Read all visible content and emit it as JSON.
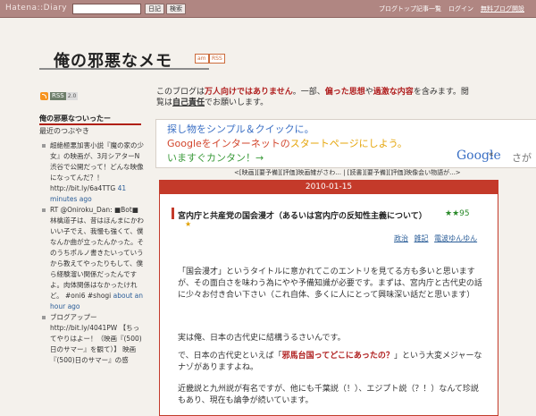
{
  "topbar": {
    "logo": "Hatena::Diary",
    "search_placeholder": "",
    "btn_diary": "日記",
    "btn_search": "検索",
    "links": [
      "ブログトップ",
      "記事一覧",
      "ログイン",
      "無料ブログ開設"
    ]
  },
  "blog": {
    "title": "俺の邪悪なメモ",
    "tag_am": "am",
    "tag_rss": "RSS"
  },
  "sidebar": {
    "rss_label": "RSS",
    "rss_version": "2.0",
    "heading": "俺の邪悪なついったー",
    "subheading": "最近のつぶやき",
    "tweets": [
      {
        "text": "超絶極悪加害小説『魔の家の少女』の映画が、3月シアターN渋谷で公開だって！どんな映像になってんだ？！ http://bit.ly/6a4TTG",
        "ago": "41 minutes ago"
      },
      {
        "text": "RT @Oniroku_Dan: ■Bot■ 林檎道子は、昔はほんまにかわいい子でえ、我慢も強くて、僕なんか曲が立ったんかった。そのうちポルノ書きたいっていうから教えてやったりもして、僕ら経験溜い関係だったんですよ。肉体関係はなかったけれど。 #oni6 #shogi",
        "ago": "about an hour ago"
      },
      {
        "text": "ブログアップー http://bit.ly/4041PW 【ちってやりはよー！（映画『(500)日のサマー』を観て）】 映画『(500)日のサマー』の感",
        "ago": ""
      }
    ]
  },
  "intro": {
    "p1": "このブログは",
    "p1_bold": "万人向けではありません",
    "p2": "。一部、",
    "p2_bold": "偏った思想",
    "p3": "や",
    "p3_bold": "過激な内容",
    "p4": "を含みます。閲覧は",
    "p4_ul": "自己責任",
    "p5": "でお願いします。"
  },
  "ad": {
    "line1": "探し物をシンプル＆クイックに。",
    "line2a": "Googleをインターネットの",
    "line2b": "スタートページにしよう。",
    "line3": "いますぐカンタン！→",
    "google": "Google",
    "chev": "«",
    "search_text": "さが",
    "colors": {
      "blue": "#3a6fc4",
      "red": "#d2452c",
      "yellow": "#e5a50a",
      "green": "#3a9a3a"
    }
  },
  "related": "<[映画][要予備][評価]映画雑がさわ... | [読書][要予備][評価]映像会い物語が...>",
  "entry": {
    "date": "2010-01-15",
    "title": "宮内庁と共産党の国会漫才（あるいは宮内庁の反知性主義について）",
    "star": "★★95",
    "addstar": "★",
    "cats": [
      "政治",
      "雑記",
      "電波ゆんゆん"
    ],
    "para1": "「国会漫才」というタイトルに意かれてこのエントリを見てる方も多いと思いますが、その面白さを味わう為にやや予備知識が必要です。まずは、宮内庁と古代史の話に少々お付き合い下さい（これ自体、多くに人にとって興味深い話だと思います）",
    "para2": "実は俺、日本の古代史に結構うるさいんです。",
    "para3a": "で、日本の古代史といえば「",
    "para3b": "邪馬台国ってどこにあったの？",
    "para3c": "」という大変メジャーなナゾがありますよね。",
    "para4": "近畿説と九州説が有名ですが、他にも千葉説（！）、エジプト説（？！）なんて珍説もあり、現在も論争が続いています。"
  }
}
